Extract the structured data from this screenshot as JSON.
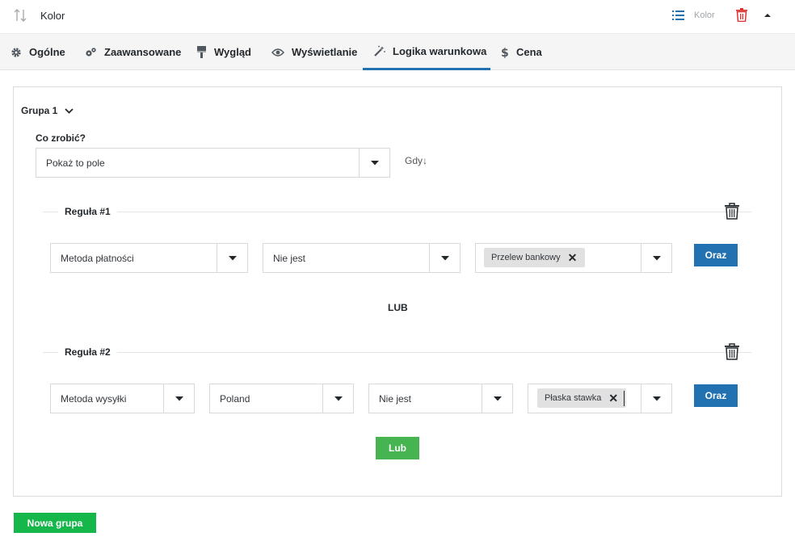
{
  "header": {
    "field_title": "Kolor",
    "field_type": "Kolor",
    "icons": {
      "sort": "sort-arrows-icon",
      "list": "list-icon",
      "delete": "trash-icon",
      "collapse": "caret-up-icon"
    },
    "delete_color": "#dc3232"
  },
  "tabs": [
    {
      "label": "Ogólne",
      "icon": "gear-icon"
    },
    {
      "label": "Zaawansowane",
      "icon": "gears-icon"
    },
    {
      "label": "Wygląd",
      "icon": "brush-icon"
    },
    {
      "label": "Wyświetlanie",
      "icon": "eye-icon"
    },
    {
      "label": "Logika warunkowa",
      "icon": "magic-wand-icon",
      "active": true
    },
    {
      "label": "Cena",
      "icon": "dollar-icon"
    }
  ],
  "group": {
    "label": "Grupa 1",
    "action_label": "Co zrobić?",
    "action_value": "Pokaż to pole",
    "when_label": "Gdy↓",
    "rules": [
      {
        "title": "Reguła #1",
        "fields": [
          "Metoda płatności",
          "Nie jest"
        ],
        "tags": [
          "Przelew bankowy"
        ],
        "and_label": "Oraz"
      },
      {
        "title": "Reguła #2",
        "fields": [
          "Metoda wysyłki",
          "Poland",
          "Nie jest"
        ],
        "tags": [
          "Płaska stawka"
        ],
        "and_label": "Oraz"
      }
    ],
    "or_separator": "LUB",
    "or_button": "Lub"
  },
  "footer": {
    "new_group": "Nowa grupa"
  },
  "colors": {
    "primary": "#2271b1",
    "success": "#46b450",
    "new_group": "#15b64a"
  }
}
